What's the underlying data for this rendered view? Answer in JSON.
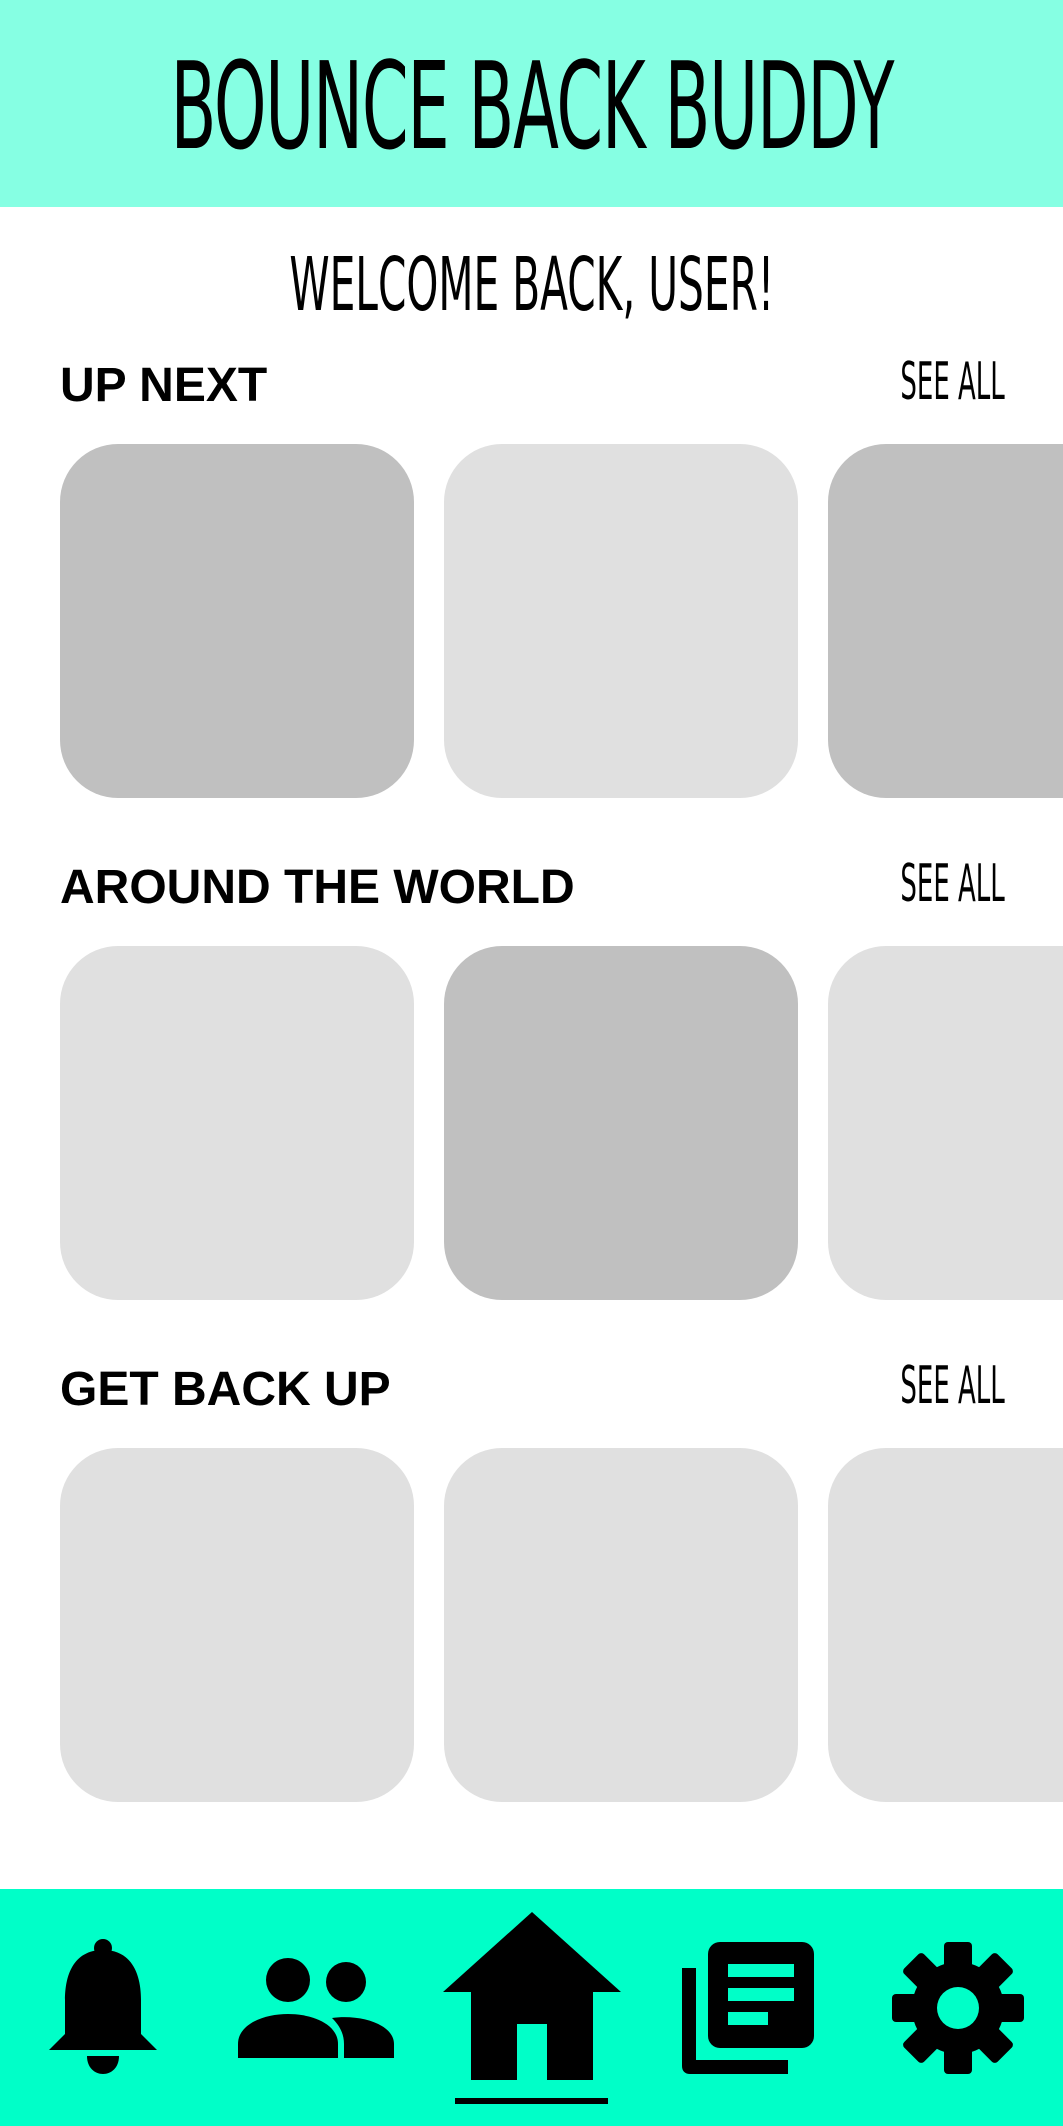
{
  "header": {
    "title": "BOUNCE BACK BUDDY",
    "background": "#86ffe3"
  },
  "welcome": {
    "text": "WELCOME BACK, USER!"
  },
  "sections": [
    {
      "title": "UP NEXT",
      "see_all": "SEE ALL",
      "cards": [
        "#c0c0c0",
        "#e0e0e0",
        "#c0c0c0"
      ]
    },
    {
      "title": "AROUND THE WORLD",
      "see_all": "SEE ALL",
      "cards": [
        "#e0e0e0",
        "#c0c0c0",
        "#e0e0e0"
      ]
    },
    {
      "title": "GET BACK UP",
      "see_all": "SEE ALL",
      "cards": [
        "#e0e0e0",
        "#e0e0e0",
        "#e0e0e0"
      ]
    }
  ],
  "bottom_nav": {
    "background": "#00ffc8",
    "items": [
      {
        "icon": "bell-icon"
      },
      {
        "icon": "people-icon"
      },
      {
        "icon": "home-icon",
        "active": true
      },
      {
        "icon": "news-icon"
      },
      {
        "icon": "gear-icon"
      }
    ]
  }
}
